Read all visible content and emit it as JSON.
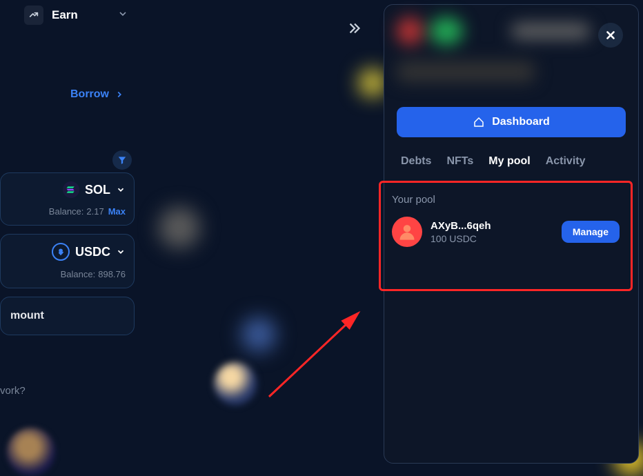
{
  "nav": {
    "earn_label": "Earn"
  },
  "breadcrumb": {
    "borrow_label": "Borrow"
  },
  "tokens": {
    "sol": {
      "name": "SOL",
      "balance_label": "Balance:",
      "balance_value": "2.17",
      "max_label": "Max"
    },
    "usdc": {
      "name": "USDC",
      "balance_label": "Balance:",
      "balance_value": "898.76"
    }
  },
  "amount_card": {
    "label": "mount"
  },
  "work_text": "vork?",
  "panel": {
    "dashboard_label": "Dashboard",
    "tabs": {
      "debts": "Debts",
      "nfts": "NFTs",
      "mypool": "My pool",
      "activity": "Activity"
    }
  },
  "pool": {
    "section_label": "Your pool",
    "id": "AXyB...6qeh",
    "amount": "100 USDC",
    "manage_label": "Manage"
  }
}
